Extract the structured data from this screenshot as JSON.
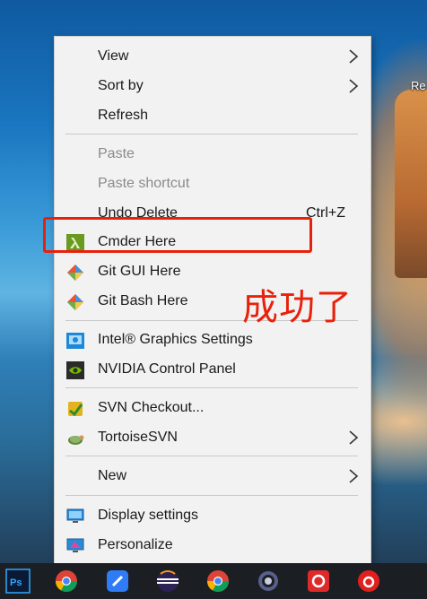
{
  "desktop": {
    "corner_label": "Re"
  },
  "menu": {
    "items": [
      {
        "label": "View",
        "shortcut": "",
        "has_submenu": true,
        "disabled": false
      },
      {
        "label": "Sort by",
        "shortcut": "",
        "has_submenu": true,
        "disabled": false
      },
      {
        "label": "Refresh",
        "shortcut": "",
        "has_submenu": false,
        "disabled": false
      },
      {
        "label": "Paste",
        "shortcut": "",
        "has_submenu": false,
        "disabled": true
      },
      {
        "label": "Paste shortcut",
        "shortcut": "",
        "has_submenu": false,
        "disabled": true
      },
      {
        "label": "Undo Delete",
        "shortcut": "Ctrl+Z",
        "has_submenu": false,
        "disabled": false
      },
      {
        "label": "Cmder Here",
        "icon": "cmder-lambda-icon",
        "has_submenu": false,
        "disabled": false
      },
      {
        "label": "Git GUI Here",
        "icon": "git-icon",
        "has_submenu": false,
        "disabled": false
      },
      {
        "label": "Git Bash Here",
        "icon": "git-icon",
        "has_submenu": false,
        "disabled": false
      },
      {
        "label": "Intel® Graphics Settings",
        "icon": "intel-graphics-icon",
        "has_submenu": false,
        "disabled": false
      },
      {
        "label": "NVIDIA Control Panel",
        "icon": "nvidia-icon",
        "has_submenu": false,
        "disabled": false
      },
      {
        "label": "SVN Checkout...",
        "icon": "svn-checkout-icon",
        "has_submenu": false,
        "disabled": false
      },
      {
        "label": "TortoiseSVN",
        "icon": "tortoisesvn-icon",
        "has_submenu": true,
        "disabled": false
      },
      {
        "label": "New",
        "has_submenu": true,
        "disabled": false
      },
      {
        "label": "Display settings",
        "icon": "display-settings-icon",
        "has_submenu": false,
        "disabled": false
      },
      {
        "label": "Personalize",
        "icon": "personalize-icon",
        "has_submenu": false,
        "disabled": false
      }
    ]
  },
  "annotation": {
    "text": "成功了",
    "color": "#e8210c"
  },
  "taskbar": {
    "icons": [
      "photoshop-icon",
      "chrome-icon",
      "messaging-app-icon",
      "eclipse-icon",
      "chrome-icon",
      "settings-gear-icon",
      "media-app-icon",
      "netease-music-icon"
    ]
  }
}
